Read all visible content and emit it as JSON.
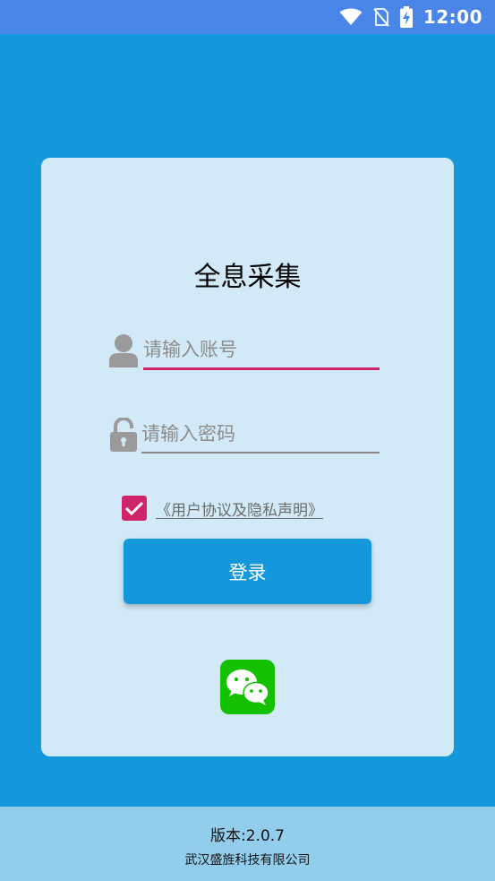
{
  "status_bar": {
    "time": "12:00",
    "icons": [
      "wifi-icon",
      "no-sim-icon",
      "battery-charging-icon"
    ],
    "color": "#4a86e8"
  },
  "login": {
    "title": "全息采集",
    "account_placeholder": "请输入账号",
    "password_placeholder": "请输入密码",
    "agree_checked": true,
    "agreement_link": "《用户协议及隐私声明》",
    "login_button": "登录",
    "wechat_icon": "wechat-icon"
  },
  "footer": {
    "version": "版本:2.0.7",
    "company": "武汉盛旌科技有限公司"
  },
  "colors": {
    "background": "#1597dc",
    "card": "#d2eaf7",
    "accent": "#d0246a",
    "wechat": "#14c000",
    "footer": "#93cdec"
  }
}
